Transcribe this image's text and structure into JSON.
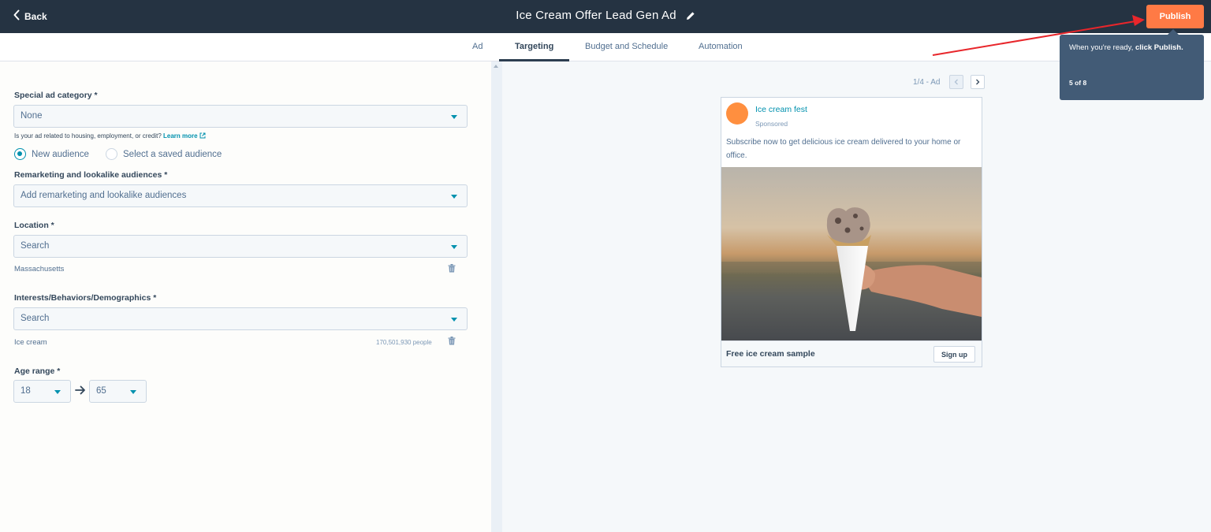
{
  "header": {
    "back_label": "Back",
    "title": "Ice Cream Offer Lead Gen Ad",
    "publish_label": "Publish",
    "bg_color": "#253342",
    "publish_color": "#ff7a45"
  },
  "tabs": [
    {
      "label": "Ad",
      "active": false
    },
    {
      "label": "Targeting",
      "active": true
    },
    {
      "label": "Budget and Schedule",
      "active": false
    },
    {
      "label": "Automation",
      "active": false
    }
  ],
  "form": {
    "special_category": {
      "label": "Special ad category *",
      "value": "None"
    },
    "hint": {
      "text": "Is your ad related to housing, employment, or credit?",
      "link": "Learn more"
    },
    "audience_options": [
      {
        "label": "New audience",
        "checked": true
      },
      {
        "label": "Select a saved audience",
        "checked": false
      }
    ],
    "remarketing": {
      "label": "Remarketing and lookalike audiences *",
      "placeholder": "Add remarketing and lookalike audiences"
    },
    "location": {
      "label": "Location *",
      "placeholder": "Search",
      "selected": "Massachusetts"
    },
    "interests": {
      "label": "Interests/Behaviors/Demographics *",
      "placeholder": "Search",
      "selected": "Ice cream",
      "people": "170,501,930 people"
    },
    "age_range": {
      "label": "Age range *",
      "min": "18",
      "max": "65"
    }
  },
  "preview": {
    "pager": "1/4 - Ad",
    "page_name": "Ice cream fest",
    "sponsored": "Sponsored",
    "body": "Subscribe now to get delicious ice cream delivered to your home or office.",
    "headline": "Free ice cream sample",
    "cta": "Sign up",
    "avatar_color": "#ff8f3f"
  },
  "tooltip": {
    "text_prefix": "When you're ready, ",
    "text_bold": "click Publish.",
    "step": "5 of 8"
  },
  "annotation_color": "#e8262b"
}
